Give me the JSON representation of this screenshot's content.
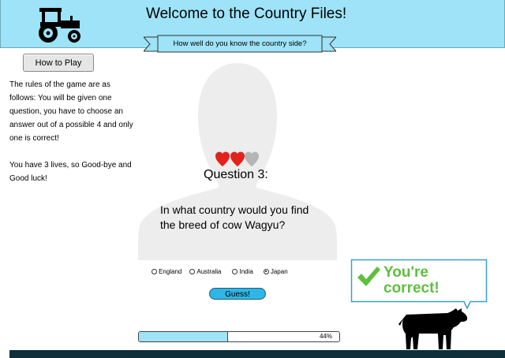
{
  "header": {
    "title": "Welcome to the Country Files!",
    "banner_text": "How well do you know the country side?",
    "background_color": "#9ee3f7",
    "logo_icon": "tractor-icon"
  },
  "sidebar": {
    "how_to_play_label": "How to Play",
    "rules_paragraph_1": "The rules of the game are as follows: You will be given one question, you have to choose an answer out of a possible 4 and only one is correct!",
    "rules_paragraph_2": "You have 3 lives, so Good-bye and Good luck!"
  },
  "game": {
    "lives_total": 3,
    "lives_remaining": 2,
    "heart_full_color": "#e0231c",
    "heart_empty_color": "#b5b5b5",
    "question_title": "Question 3:",
    "question_text": "In what country would you find the breed of cow Wagyu?",
    "options": [
      {
        "label": "England",
        "selected": false
      },
      {
        "label": "Australia",
        "selected": false
      },
      {
        "label": "India",
        "selected": false
      },
      {
        "label": "Japan",
        "selected": true
      }
    ],
    "guess_label": "Guess!",
    "feedback_text": "You're correct!",
    "feedback_color": "#5fbf3f"
  },
  "progress": {
    "percent": 44,
    "label": "44%",
    "fill_color": "#9ee3f7"
  }
}
